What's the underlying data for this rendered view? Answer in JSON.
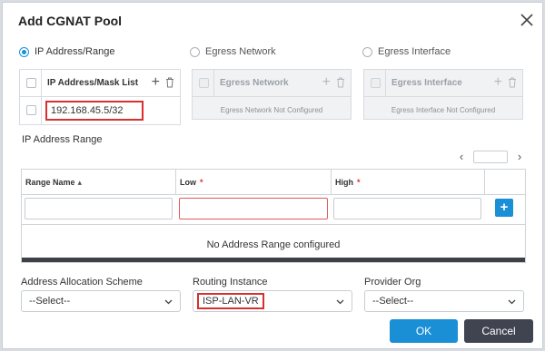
{
  "dialog": {
    "title": "Add CGNAT Pool"
  },
  "source_options": [
    {
      "label": "IP Address/Range",
      "selected": true
    },
    {
      "label": "Egress Network",
      "selected": false
    },
    {
      "label": "Egress Interface",
      "selected": false
    }
  ],
  "ip_list": {
    "header": "IP Address/Mask List",
    "rows": [
      "192.168.45.5/32"
    ]
  },
  "egress_network": {
    "header": "Egress Network",
    "empty_text": "Egress Network Not Configured"
  },
  "egress_interface": {
    "header": "Egress Interface",
    "empty_text": "Egress Interface Not Configured"
  },
  "range_section": {
    "label": "IP Address Range",
    "columns": [
      "Range Name",
      "Low",
      "High"
    ],
    "empty_text": "No Address Range configured"
  },
  "fields": {
    "allocation": {
      "label": "Address Allocation Scheme",
      "value": "--Select--"
    },
    "routing": {
      "label": "Routing Instance",
      "value": "ISP-LAN-VR"
    },
    "provider": {
      "label": "Provider Org",
      "value": "--Select--"
    }
  },
  "buttons": {
    "ok": "OK",
    "cancel": "Cancel"
  },
  "colors": {
    "primary": "#1a8fd6",
    "highlight": "#d92f2f",
    "cancel": "#3f4450"
  }
}
